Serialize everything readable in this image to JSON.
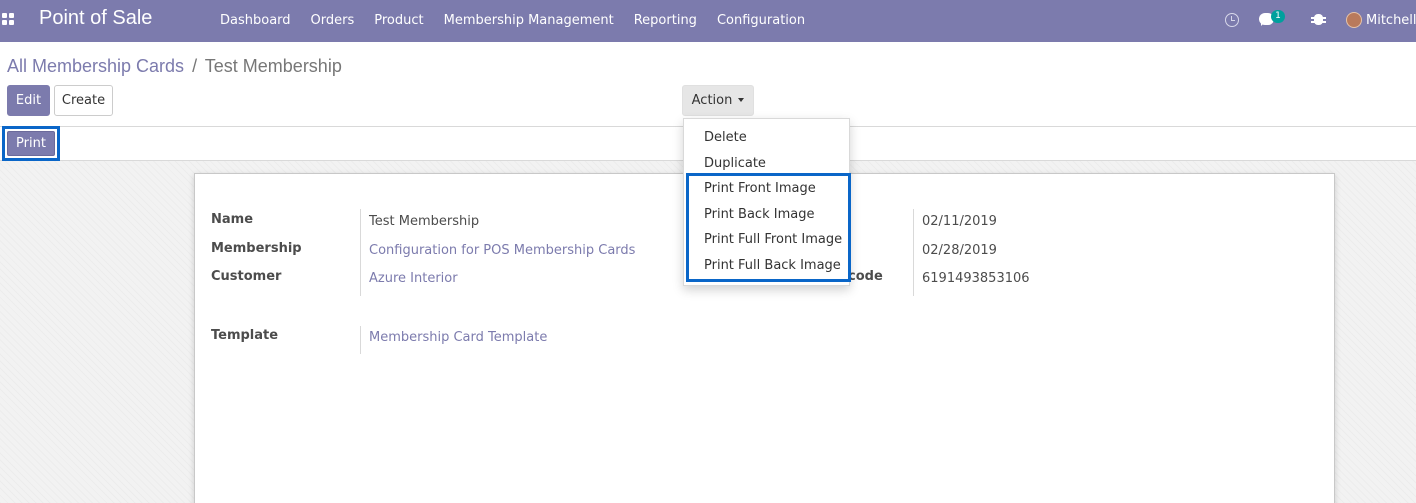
{
  "navbar": {
    "brand": "Point of Sale",
    "menu": [
      "Dashboard",
      "Orders",
      "Product",
      "Membership Management",
      "Reporting",
      "Configuration"
    ],
    "chat_badge": "1",
    "user_name": "Mitchell"
  },
  "breadcrumb": {
    "parent": "All Membership Cards",
    "separator": "/",
    "current": "Test Membership"
  },
  "buttons": {
    "edit": "Edit",
    "create": "Create",
    "action": "Action",
    "print": "Print"
  },
  "action_menu": [
    "Delete",
    "Duplicate",
    "Print Front Image",
    "Print Back Image",
    "Print Full Front Image",
    "Print Full Back Image"
  ],
  "form": {
    "name_label": "Name",
    "name_value": "Test Membership",
    "membership_label": "Membership",
    "membership_value": "Configuration for POS Membership Cards",
    "customer_label": "Customer",
    "customer_value": "Azure Interior",
    "template_label": "Template",
    "template_value": "Membership Card Template",
    "date1_value": "02/11/2019",
    "date2_value": "02/28/2019",
    "code_label_partial": "code",
    "code_value": "6191493853106"
  },
  "colors": {
    "brand": "#7c7bad",
    "highlight": "#0a66c8",
    "badge": "#00a09d"
  }
}
